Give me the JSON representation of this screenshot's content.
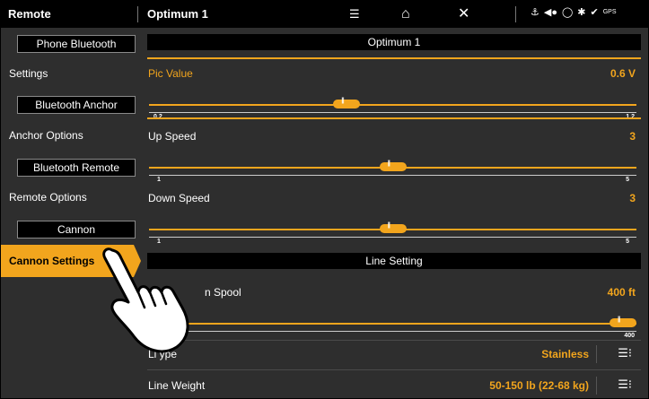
{
  "topbar": {
    "left_title": "Remote",
    "mid_title": "Optimum 1",
    "icons": [
      "waypoint-mark-icon",
      "home-icon",
      "close-x-icon"
    ],
    "status_icons": [
      "anchor-status-icon",
      "trolling-motor-icon",
      "autopilot-icon",
      "network-icon",
      "check-icon",
      "gps-icon"
    ],
    "gps_label": "GPS"
  },
  "sidebar": {
    "phone_bluetooth": "Phone Bluetooth",
    "settings": "Settings",
    "bluetooth_anchor": "Bluetooth Anchor",
    "anchor_options": "Anchor Options",
    "bluetooth_remote": "Bluetooth Remote",
    "remote_options": "Remote Options",
    "cannon": "Cannon",
    "cannon_settings": "Cannon Settings"
  },
  "content": {
    "header_title": "Optimum 1",
    "pic_value": {
      "label": "Pic Value",
      "value": "0.6 V",
      "min": "0.2",
      "max": "1.2",
      "fraction": 0.4
    },
    "up_speed": {
      "label": "Up Speed",
      "value": "3",
      "min": "1",
      "max": "5",
      "fraction": 0.5
    },
    "down_speed": {
      "label": "Down Speed",
      "value": "3",
      "min": "1",
      "max": "5",
      "fraction": 0.5
    },
    "line_setting_header": "Line Setting",
    "line_on_spool": {
      "label": "n Spool",
      "value": "400 ft",
      "max": "400",
      "fraction": 1.0
    },
    "line_type": {
      "label": "Li    ype",
      "value": "Stainless"
    },
    "line_weight": {
      "label": "Line Weight",
      "value": "50-150 lb (22-68 kg)"
    }
  },
  "colors": {
    "accent": "#f2a51d",
    "bar": "#000000",
    "panel": "#2e2e2e"
  }
}
